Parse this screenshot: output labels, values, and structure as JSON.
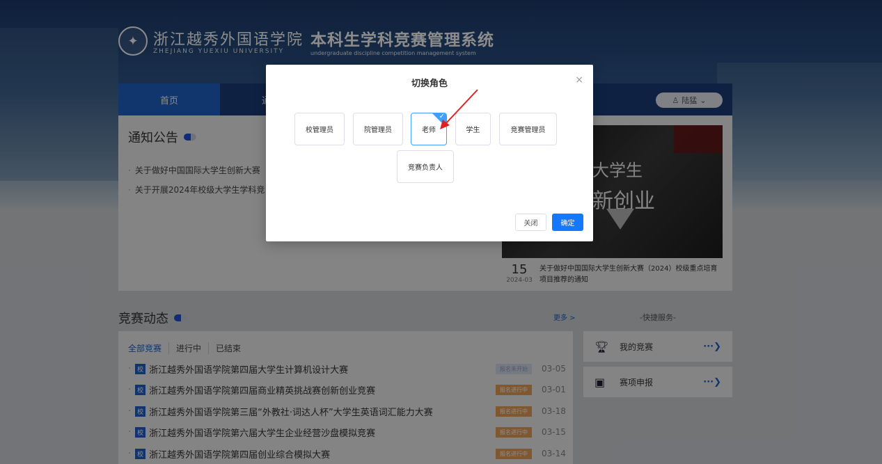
{
  "header": {
    "school_cn": "浙江越秀外国语学院",
    "school_en": "ZHEJIANG YUEXIU UNIVERSITY",
    "system_cn": "本科生学科竞赛管理系统",
    "system_en": "undergraduate discipline competition management system"
  },
  "nav": {
    "items": [
      {
        "label": "首页"
      },
      {
        "label": "通知"
      }
    ],
    "user_label": "陆猛",
    "user_icon": "user-icon"
  },
  "notice": {
    "title": "通知公告",
    "items": [
      {
        "text": "关于做好中国国际大学生创新大赛（"
      },
      {
        "text": "关于开展2024年校级大学生学科竞"
      }
    ],
    "banner_line1": "大学生",
    "banner_line2": "新创业",
    "news_day": "15",
    "news_ym": "2024-03",
    "news_text": "关于做好中国国际大学生创新大赛（2024）校级重点培育项目推荐的通知"
  },
  "competitions": {
    "title": "竞赛动态",
    "more": "更多 >",
    "tabs": [
      "全部竞赛",
      "进行中",
      "已结束"
    ],
    "tag_label": "校",
    "rows": [
      {
        "name": "浙江越秀外国语学院第四届大学生计算机设计大赛",
        "status": "报名未开始",
        "date": "03-05"
      },
      {
        "name": "浙江越秀外国语学院第四届商业精英挑战赛创新创业竞赛",
        "status": "报名进行中",
        "date": "03-01"
      },
      {
        "name": "浙江越秀外国语学院第三届“外教社·词达人杯”大学生英语词汇能力大赛",
        "status": "报名进行中",
        "date": "03-18"
      },
      {
        "name": "浙江越秀外国语学院第六届大学生企业经营沙盘模拟竞赛",
        "status": "报名进行中",
        "date": "03-15"
      },
      {
        "name": "浙江越秀外国语学院第四届创业综合模拟大赛",
        "status": "报名进行中",
        "date": "03-14"
      }
    ]
  },
  "quick": {
    "title": "-快捷服务-",
    "items": [
      {
        "label": "我的竞赛",
        "icon": "trophy-icon"
      },
      {
        "label": "赛项申报",
        "icon": "stamp-icon"
      }
    ],
    "arrow": "···❯"
  },
  "modal": {
    "title": "切换角色",
    "close": "×",
    "roles": [
      "校管理员",
      "院管理员",
      "老师",
      "学生",
      "竞赛管理员",
      "竞赛负责人"
    ],
    "selected_role": "老师",
    "cancel_label": "关闭",
    "ok_label": "确定",
    "accent": "#409eff",
    "ok_color": "#1677ff"
  }
}
